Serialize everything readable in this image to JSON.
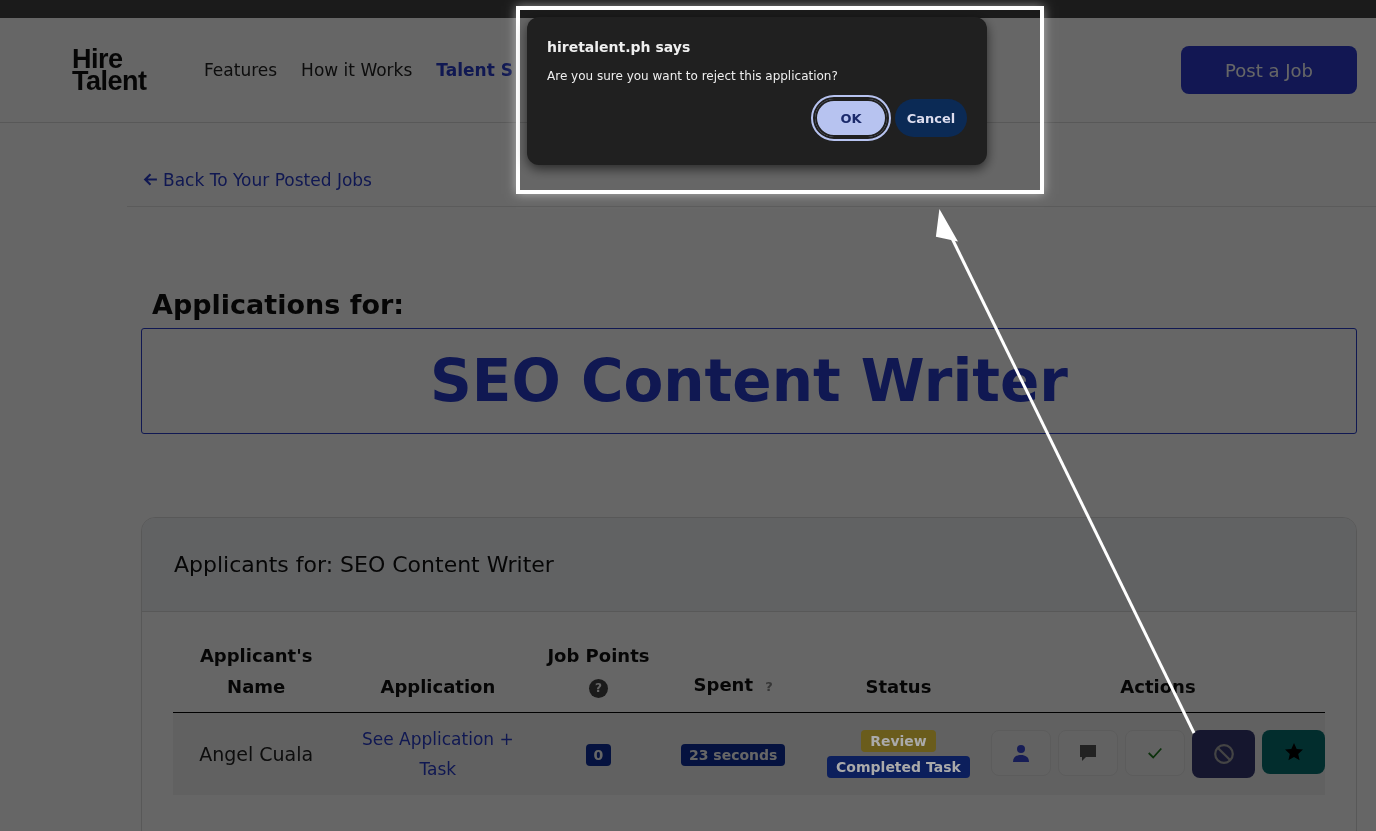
{
  "header": {
    "logo": [
      "Hire",
      "Talent"
    ],
    "nav": [
      {
        "label": "Features",
        "selected": false
      },
      {
        "label": "How it Works",
        "selected": false
      },
      {
        "label": "Talent S",
        "selected": true
      }
    ],
    "post_button": "Post a Job"
  },
  "back_link": "Back To Your Posted Jobs",
  "heading": "Applications for:",
  "job_title": "SEO Content Writer",
  "card": {
    "title": "Applicants for: SEO Content Writer",
    "columns": [
      {
        "label": "Applicant's Name"
      },
      {
        "label": "Application"
      },
      {
        "label": "Job Points",
        "help": {
          "text": "?",
          "kind": "circle"
        }
      },
      {
        "label": "Spent",
        "help": {
          "text": "?",
          "kind": "plain"
        }
      },
      {
        "label": "Status"
      },
      {
        "label": "Actions"
      }
    ],
    "rows": [
      {
        "name": "Angel Cuala",
        "application": "See Application + Task",
        "points": "0",
        "spent": "23 seconds",
        "status": [
          {
            "label": "Review",
            "color": "#6a5c1c"
          },
          {
            "label": "Completed Task",
            "color": "#0c1f5c"
          }
        ],
        "actions": [
          {
            "kind": "profile"
          },
          {
            "kind": "message"
          },
          {
            "kind": "approve"
          },
          {
            "kind": "reject"
          },
          {
            "kind": "shortlist"
          }
        ]
      }
    ]
  },
  "dialog": {
    "title": "hiretalent.ph says",
    "message": "Are you sure you want to reject this application?",
    "buttons": [
      {
        "label": "OK",
        "selected": true
      },
      {
        "label": "Cancel",
        "selected": false
      }
    ]
  },
  "annotation": {
    "kind": "arrow"
  }
}
